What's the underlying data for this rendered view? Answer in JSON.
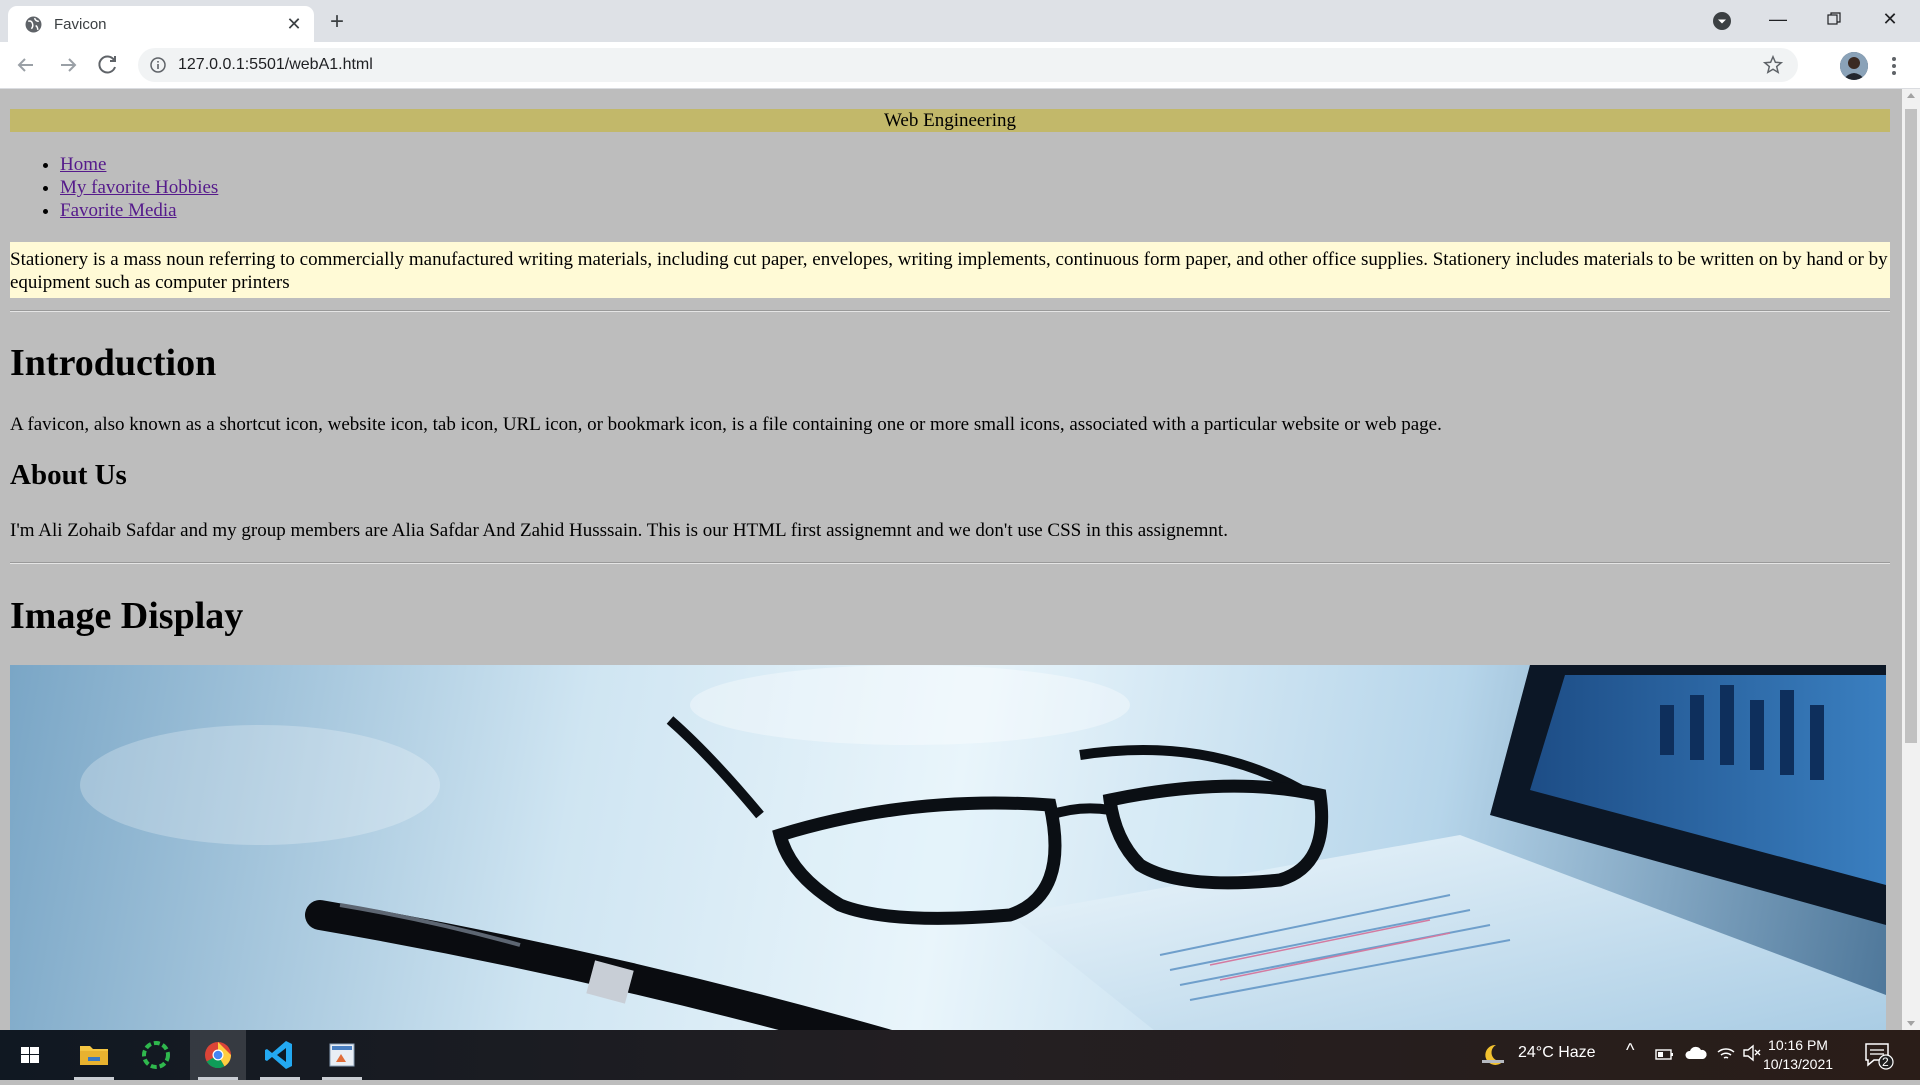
{
  "browser": {
    "tab_title": "Favicon",
    "url": "127.0.0.1:5501/webA1.html"
  },
  "page": {
    "banner": "Web Engineering",
    "nav": [
      "Home",
      "My favorite Hobbies",
      "Favorite Media"
    ],
    "note": "Stationery is a mass noun referring to commercially manufactured writing materials, including cut paper, envelopes, writing implements, continuous form paper, and other office supplies. Stationery includes materials to be written on by hand or by equipment such as computer printers",
    "intro_heading": "Introduction",
    "intro_text": "A favicon, also known as a shortcut icon, website icon, tab icon, URL icon, or bookmark icon, is a file containing one or more small icons, associated with a particular website or web page.",
    "about_heading": "About Us",
    "about_text": "I'm Ali Zohaib Safdar and my group members are Alia Safdar And Zahid Husssain. This is our HTML first assignemnt and we don't use CSS in this assignemnt.",
    "image_heading": "Image Display",
    "image_subject": "glasses-and-pen-photo"
  },
  "taskbar": {
    "weather": "24°C  Haze",
    "time": "10:16 PM",
    "date": "10/13/2021",
    "notifications": "2"
  },
  "colors": {
    "banner_bg": "#c2b86a",
    "note_bg": "#fffad6",
    "page_bg": "#bdbdbd",
    "link": "#551a8b"
  }
}
